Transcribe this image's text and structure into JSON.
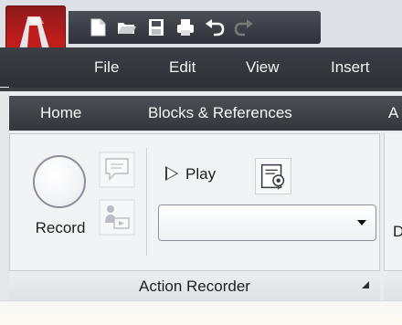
{
  "window": {
    "menu": [
      "File",
      "Edit",
      "View",
      "Insert"
    ]
  },
  "ribbon": {
    "tabs": [
      "Home",
      "Blocks & References",
      "A"
    ]
  },
  "panel": {
    "record_label": "Record",
    "play_label": "Play",
    "title": "Action Recorder",
    "dropdown_value": "",
    "next_panel_letter": "D"
  },
  "qat_icons": [
    "new-icon",
    "open-icon",
    "save-icon",
    "print-icon",
    "undo-icon",
    "redo-icon"
  ],
  "colors": {
    "app_button": "#c11d1d",
    "bar_dark": "#2d3035",
    "panel_bg": "#f2f3f5"
  }
}
